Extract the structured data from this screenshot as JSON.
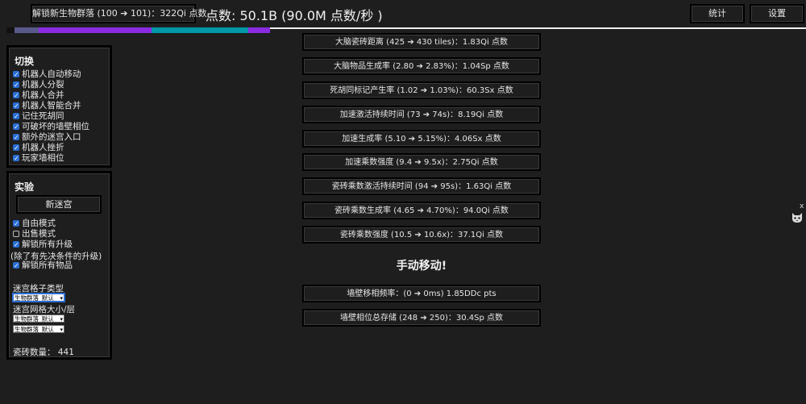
{
  "topbar": {
    "unlock_label": "解锁新生物群落 (100 ➔ 101)：322Qi 点数",
    "score_text": "点数: 50.1B (90.0M  点数/秒 )",
    "stats_label": "统计",
    "settings_label": "设置"
  },
  "toggles": {
    "title": "切换",
    "items": [
      {
        "label": "机器人自动移动",
        "checked": true
      },
      {
        "label": "机器人分裂",
        "checked": true
      },
      {
        "label": "机器人合并",
        "checked": true
      },
      {
        "label": "机器人智能合并",
        "checked": true
      },
      {
        "label": "记住死胡同",
        "checked": true
      },
      {
        "label": "可破坏的墙壁相位",
        "checked": true
      },
      {
        "label": "额外的迷宫入口",
        "checked": true
      },
      {
        "label": "机器人挫折",
        "checked": true
      },
      {
        "label": "玩家墙相位",
        "checked": true
      }
    ]
  },
  "experiment": {
    "title": "实验",
    "new_maze_label": "新迷宫",
    "options": [
      {
        "label": "自由模式",
        "checked": true
      },
      {
        "label": "出售模式",
        "checked": false
      },
      {
        "label": "解锁所有升级",
        "checked": true
      }
    ],
    "upgrades_note": "(除了有先决条件的升级)",
    "unlock_items": {
      "label": "解锁所有物品",
      "checked": true
    },
    "cell_type_label": "迷宫格子类型",
    "cell_type_value": "生物群落_默认",
    "grid_size_label": "迷宫网格大小/层",
    "grid_size_value_1": "生物群落_默认",
    "grid_size_value_2": "生物群落_默认",
    "tile_count": "瓷砖数量： 441"
  },
  "upgrades": [
    "大脑瓷砖距离 (425 ➔ 430 tiles)：1.83Qi 点数",
    "大脑物品生成率 (2.80 ➔ 2.83%)：1.04Sp 点数",
    "死胡同标记产生率 (1.02 ➔ 1.03%)：60.3Sx 点数",
    "加速激活持续时间 (73 ➔ 74s)：8.19Qi 点数",
    "加速生成率 (5.10 ➔ 5.15%)：4.06Sx 点数",
    "加速乘数强度 (9.4 ➔ 9.5x)：2.75Qi 点数",
    "瓷砖乘数激活持续时间 (94 ➔ 95s)：1.63Qi 点数",
    "瓷砖乘数生成率 (4.65 ➔ 4.70%)：94.0Qi 点数",
    "瓷砖乘数强度 (10.5 ➔ 10.6x)：37.1Qi 点数"
  ],
  "manual": {
    "title": "手动移动!",
    "upgrades": [
      "墙壁移相频率：(0 ➔ 0ms) 1.85DDc pts",
      "墙壁相位总存储 (248 ➔ 250)：30.4Sp 点数"
    ]
  },
  "side": {
    "close_label": "x",
    "icon": "cat-icon"
  },
  "colors": {
    "background": "#1e1e1e",
    "accent": "#2a6ed4",
    "maze_purple": "#8a2be2",
    "maze_teal": "#00bcd4"
  }
}
